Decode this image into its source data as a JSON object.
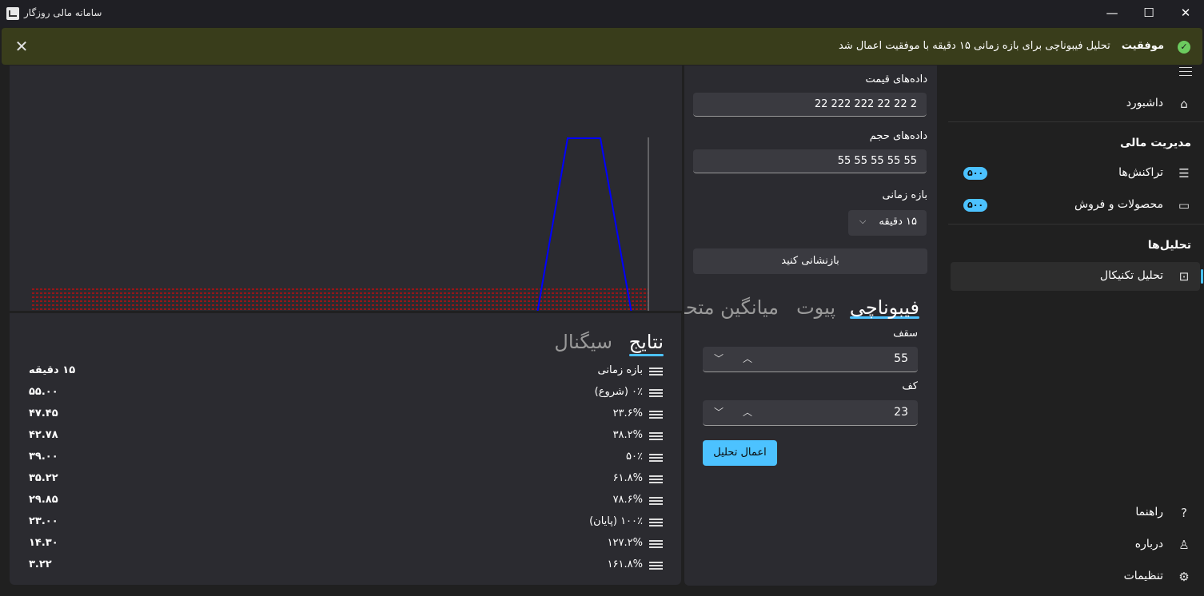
{
  "window": {
    "title": "سامانه مالی روزگار",
    "minimize_glyph": "—",
    "maximize_glyph": "☐",
    "close_glyph": "✕"
  },
  "notification": {
    "title": "موفقیت",
    "message": "تحلیل فیبوناچی برای بازه زمانی ۱۵ دقیقه با موفقیت اعمال شد",
    "close_glyph": "✕",
    "status": "success",
    "color": "#6ccb5f"
  },
  "chart_data": {
    "type": "line",
    "series_color": "#0000ff",
    "level_color": "#ff0000"
  },
  "results": {
    "tabs": [
      "نتایج",
      "سیگنال"
    ],
    "active_tab": "نتایج",
    "rows": [
      {
        "label": "بازه زمانی",
        "value": "۱۵ دقیقه"
      },
      {
        "label": "۰٪ (شروع)",
        "value": "۵۵.۰۰"
      },
      {
        "label": "۲۳.۶%",
        "value": "۴۷.۴۵"
      },
      {
        "label": "۳۸.۲%",
        "value": "۴۲.۷۸"
      },
      {
        "label": "۵۰٪",
        "value": "۳۹.۰۰"
      },
      {
        "label": "۶۱.۸%",
        "value": "۳۵.۲۲"
      },
      {
        "label": "۷۸.۶%",
        "value": "۲۹.۸۵"
      },
      {
        "label": "۱۰۰٪ (پایان)",
        "value": "۲۳.۰۰"
      },
      {
        "label": "۱۲۷.۲%",
        "value": "۱۴.۳۰"
      },
      {
        "label": "۱۶۱.۸%",
        "value": "۳.۲۲"
      }
    ]
  },
  "settings": {
    "price_label": "داده‌های قیمت",
    "price_value": "22 222 222 22 22 2",
    "volume_label": "داده‌های حجم",
    "volume_value": "55 55 55 55 55",
    "timeframe_label": "بازه زمانی",
    "timeframe_value": "۱۵ دقیقه",
    "reset_label": "بازنشانی کنید",
    "analysis_tabs": [
      "فیبوناچی",
      "پیوت",
      "میانگین متحرک"
    ],
    "active_analysis_tab": "فیبوناچی",
    "high_label": "سقف",
    "high_value": "55",
    "low_label": "کف",
    "low_value": "23",
    "apply_label": "اعمال تحلیل",
    "accent": "#4cc2ff"
  },
  "nav": {
    "menu_icon": "hamburger-icon",
    "dashboard": "داشبورد",
    "finance_header": "مدیریت مالی",
    "transactions": "تراکنش‌ها",
    "transactions_badge": "۵۰۰",
    "products": "محصولات و فروش",
    "products_badge": "۵۰۰",
    "analysis_header": "تحلیل‌ها",
    "technical": "تحلیل تکنیکال",
    "help": "راهنما",
    "about": "درباره",
    "settings": "تنظیمات"
  }
}
